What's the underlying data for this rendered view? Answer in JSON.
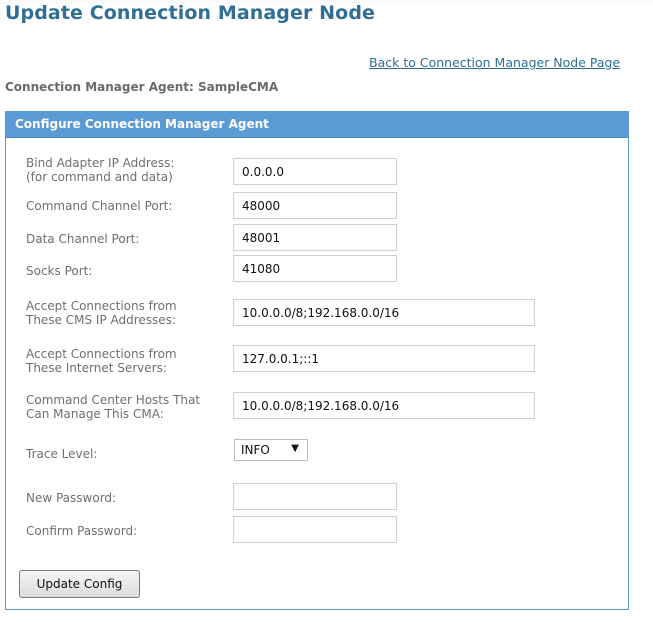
{
  "page": {
    "title": "Update Connection Manager Node",
    "back_link": "Back to Connection Manager Node Page",
    "agent_line": "Connection Manager Agent: SampleCMA"
  },
  "panel": {
    "header": "Configure Connection Manager Agent",
    "fields": [
      {
        "label_line1": "Bind Adapter IP Address:",
        "label_line2": "(for command and data)",
        "value": "0.0.0.0"
      },
      {
        "label_line1": "Command Channel Port:",
        "value": "48000"
      },
      {
        "label_line1": "Data Channel Port:",
        "value": "48001"
      },
      {
        "label_line1": "Socks Port:",
        "value": "41080"
      },
      {
        "label_line1": "Accept Connections from",
        "label_line2": "These CMS IP Addresses:",
        "value": "10.0.0.0/8;192.168.0.0/16"
      },
      {
        "label_line1": "Accept Connections from",
        "label_line2": "These Internet Servers:",
        "value": "127.0.0.1;::1"
      },
      {
        "label_line1": "Command Center Hosts That",
        "label_line2": "Can Manage This CMA:",
        "value": "10.0.0.0/8;192.168.0.0/16"
      }
    ],
    "trace": {
      "label": "Trace Level:",
      "selected": "INFO",
      "arrow": "▼"
    },
    "passwords": {
      "new_label": "New Password:",
      "new_value": "",
      "confirm_label": "Confirm Password:",
      "confirm_value": ""
    },
    "button": "Update Config"
  }
}
